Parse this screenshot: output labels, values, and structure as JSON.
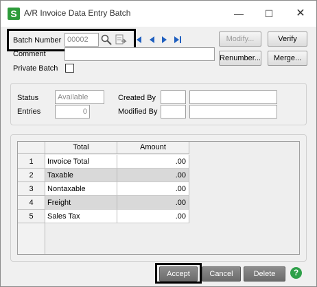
{
  "window": {
    "title": "A/R Invoice Data Entry Batch",
    "app_icon_letter": "S",
    "minimize_glyph": "—",
    "maximize_glyph": "☐",
    "close_glyph": "✕"
  },
  "batch": {
    "label": "Batch Number",
    "value": "00002"
  },
  "comment": {
    "label": "Comment",
    "value": ""
  },
  "private_batch": {
    "label": "Private Batch",
    "checked": false
  },
  "buttons": {
    "modify": "Modify...",
    "verify": "Verify",
    "renumber": "Renumber...",
    "merge": "Merge...",
    "accept": "Accept",
    "cancel": "Cancel",
    "delete": "Delete"
  },
  "info": {
    "status_label": "Status",
    "status_value": "Available",
    "entries_label": "Entries",
    "entries_value": "0",
    "created_by_label": "Created By",
    "created_by_user": "",
    "created_by_date": "",
    "modified_by_label": "Modified By",
    "modified_by_user": "",
    "modified_by_date": ""
  },
  "grid": {
    "columns": [
      "Total",
      "Amount"
    ],
    "rows": [
      {
        "num": "1",
        "total": "Invoice Total",
        "amount": ".00"
      },
      {
        "num": "2",
        "total": "Taxable",
        "amount": ".00"
      },
      {
        "num": "3",
        "total": "Nontaxable",
        "amount": ".00"
      },
      {
        "num": "4",
        "total": "Freight",
        "amount": ".00"
      },
      {
        "num": "5",
        "total": "Sales Tax",
        "amount": ".00"
      }
    ]
  },
  "help": {
    "glyph": "?"
  },
  "colors": {
    "app_icon": "#2d9b3a",
    "nav_arrows": "#1f5fbf",
    "help_icon": "#2fa04a"
  }
}
